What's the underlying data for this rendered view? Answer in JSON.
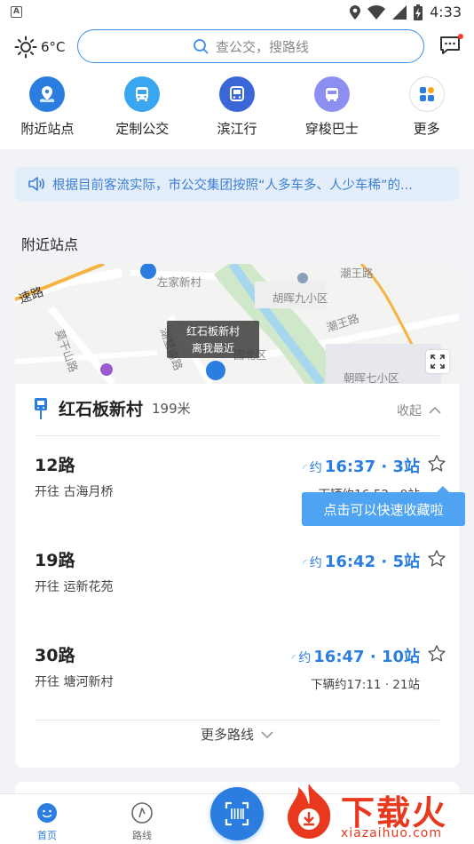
{
  "status_bar": {
    "time": "4:33"
  },
  "header": {
    "weather": {
      "icon": "sun-icon",
      "temp": "6°C"
    },
    "search_placeholder": "查公交，搜路线"
  },
  "quick_actions": [
    {
      "label": "附近站点",
      "icon": "map-pin-icon",
      "color": "#2b7de0"
    },
    {
      "label": "定制公交",
      "icon": "bus-icon",
      "color": "#3aa6f2"
    },
    {
      "label": "滨江行",
      "icon": "bus-front-icon",
      "color": "#3a66d8"
    },
    {
      "label": "穿梭巴士",
      "icon": "shuttle-bus-icon",
      "color": "#8d8ff0"
    },
    {
      "label": "更多",
      "icon": "grid-icon",
      "color": "#ffffff"
    }
  ],
  "notice": {
    "text": "根据目前客流实际，市公交集团按照“人多车多、人少车稀”的..."
  },
  "nearby": {
    "title": "附近站点",
    "map": {
      "labels": [
        "速路",
        "左家新村",
        "胡晖九小区",
        "潮王路",
        "潮王路",
        "莫干山路",
        "湖墅南路",
        "园北区",
        "朝晖七小区"
      ],
      "tooltip_line1": "红石板新村",
      "tooltip_line2": "离我最近"
    },
    "stop": {
      "name": "红石板新村",
      "distance": "199米",
      "collapse_label": "收起"
    },
    "routes": [
      {
        "name": "12路",
        "direction": "开往 古海月桥",
        "approx": "约",
        "arrival": "16:37 · 3站",
        "next": "下辆约16:52 · 9站"
      },
      {
        "name": "19路",
        "direction": "开往 运新花苑",
        "approx": "约",
        "arrival": "16:42 · 5站",
        "next": ""
      },
      {
        "name": "30路",
        "direction": "开往 塘河新村",
        "approx": "约",
        "arrival": "16:47 · 10站",
        "next": "下辆约17:11 · 21站"
      }
    ],
    "toast": "点击可以快速收藏啦",
    "more_routes": "更多路线"
  },
  "tabbar": {
    "tabs": [
      {
        "label": "首页",
        "icon": "home-face-icon"
      },
      {
        "label": "路线",
        "icon": "compass-icon"
      }
    ],
    "scan_icon": "scan-icon"
  },
  "watermark": {
    "text": "下载火",
    "sub": "xiazaihuo.com"
  }
}
